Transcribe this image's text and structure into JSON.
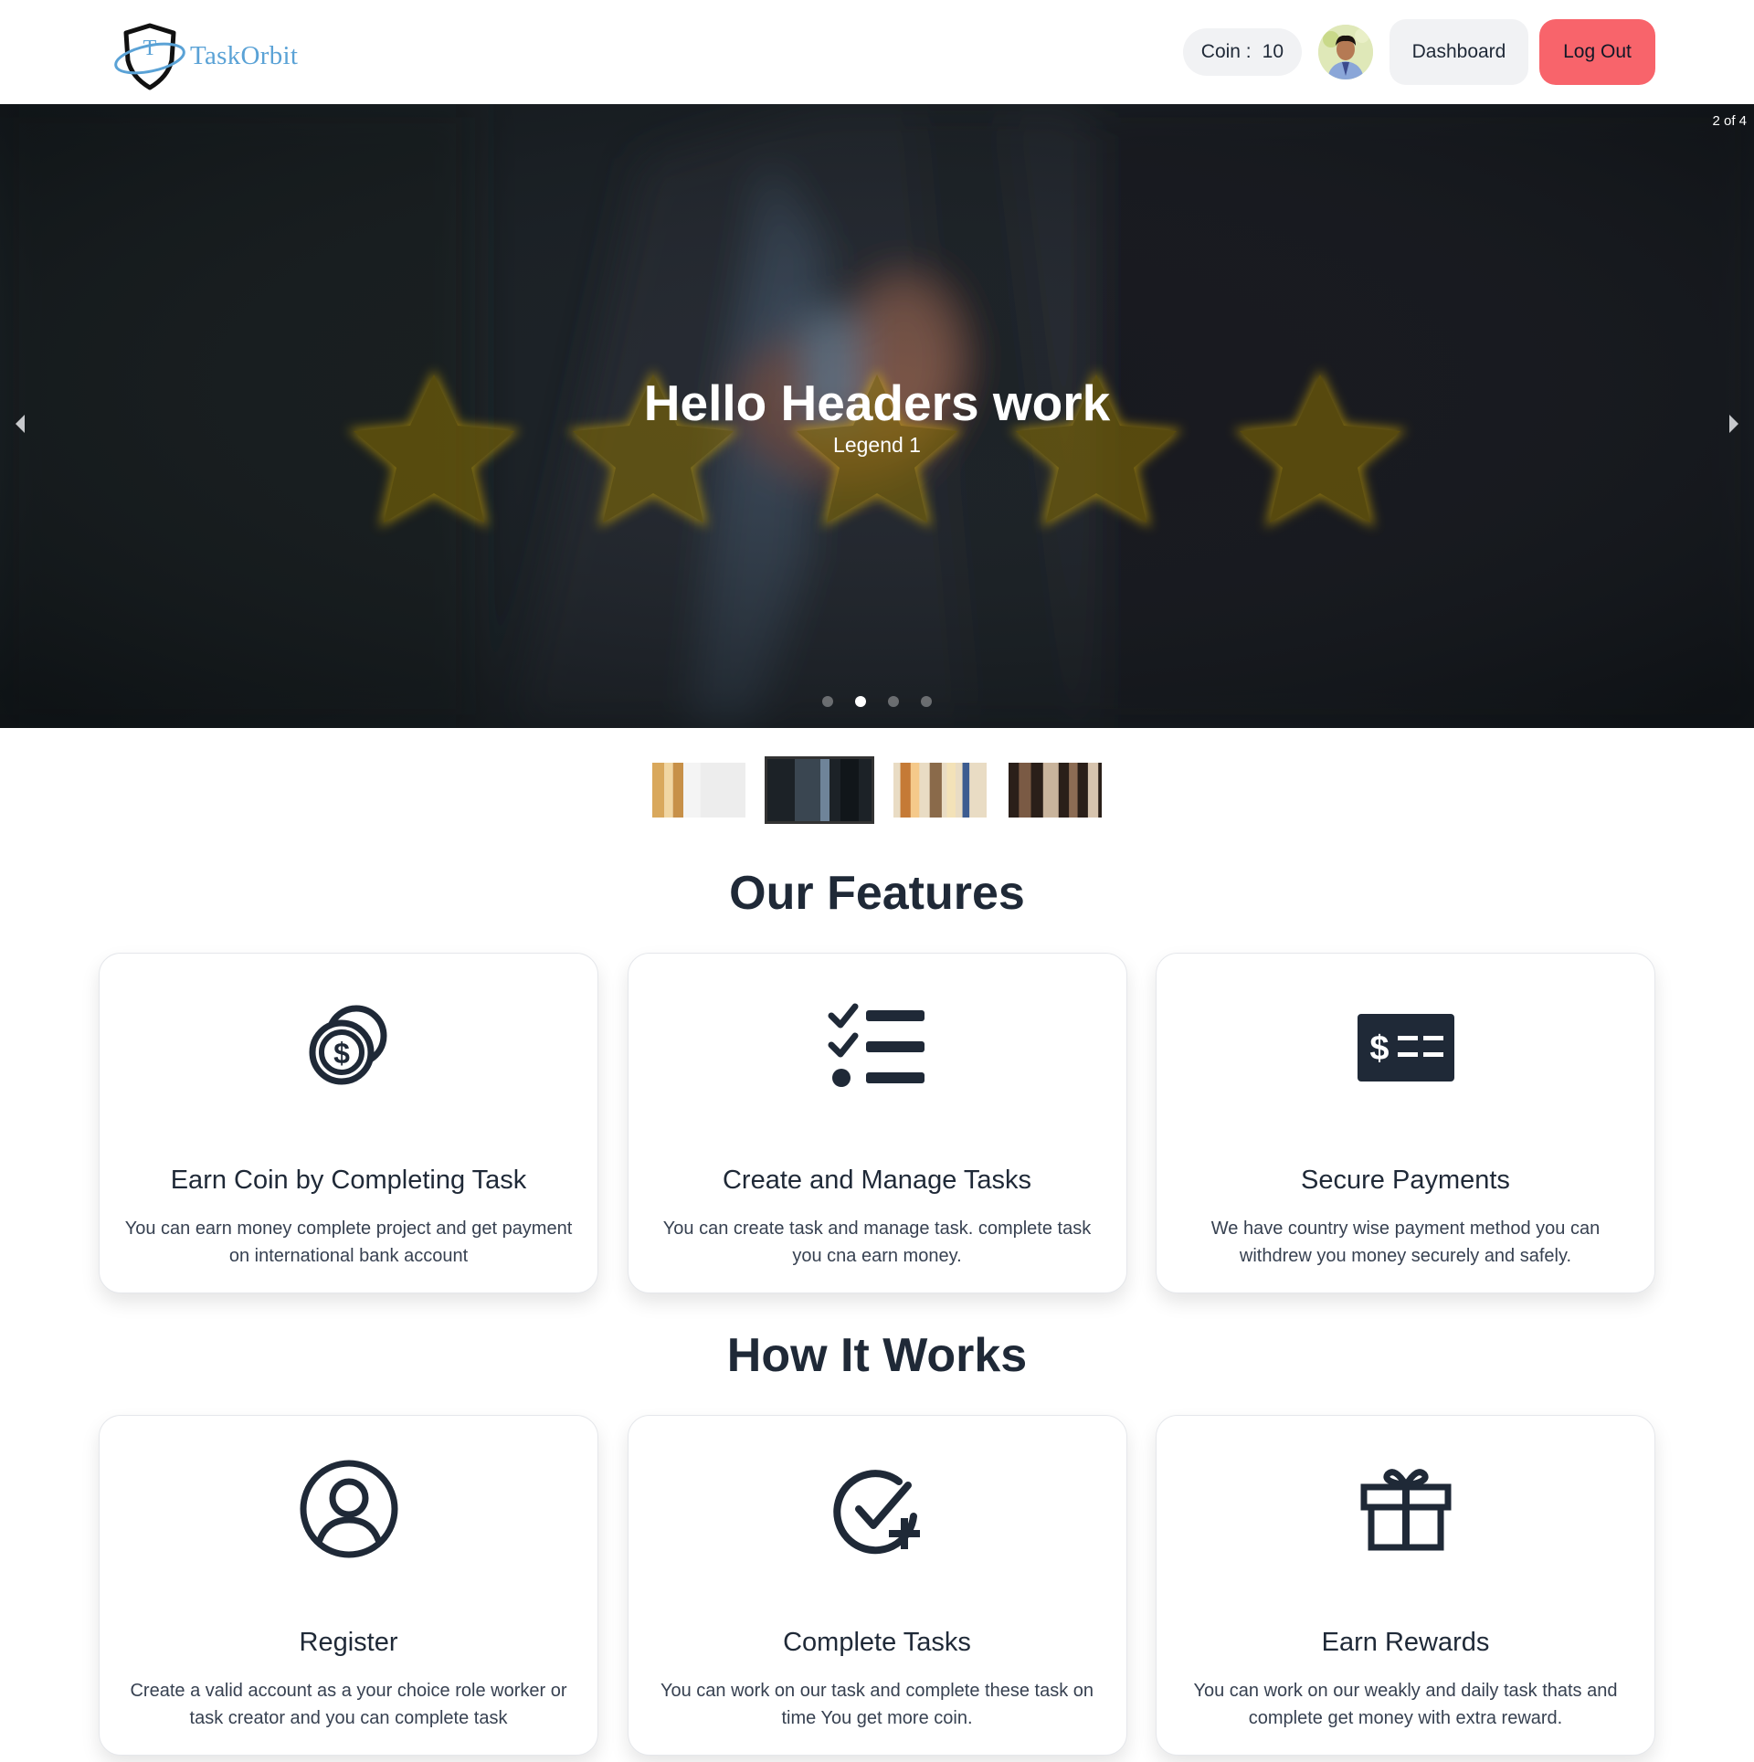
{
  "brand": {
    "name": "TaskOrbit",
    "logo_letter": "T"
  },
  "nav": {
    "coin_label": "Coin :",
    "coin_value": "10",
    "dashboard_label": "Dashboard",
    "logout_label": "Log Out"
  },
  "carousel": {
    "counter": "2 of 4",
    "title": "Hello Headers work",
    "legend": "Legend 1",
    "total_slides": 4,
    "active_slide": 2,
    "prev_icon": "arrow-left-icon",
    "next_icon": "arrow-right-icon"
  },
  "features": {
    "title": "Our Features",
    "cards": [
      {
        "icon": "coins-icon",
        "title": "Earn Coin by Completing Task",
        "text": "You can earn money complete project and get payment on international bank account"
      },
      {
        "icon": "task-list-icon",
        "title": "Create and Manage Tasks",
        "text": "You can create task and manage task. complete task you cna earn money."
      },
      {
        "icon": "payment-check-icon",
        "title": "Secure Payments",
        "text": "We have country wise payment method you can withdrew you money securely and safely."
      }
    ]
  },
  "how_it_works": {
    "title": "How It Works",
    "cards": [
      {
        "icon": "user-circle-icon",
        "title": "Register",
        "text": "Create a valid account as a your choice role worker or task creator and you can complete task"
      },
      {
        "icon": "check-plus-icon",
        "title": "Complete Tasks",
        "text": "You can work on our task and complete these task on time You get more coin."
      },
      {
        "icon": "gift-icon",
        "title": "Earn Rewards",
        "text": "You can work on our weakly and daily task thats and complete get money with extra reward."
      }
    ]
  },
  "colors": {
    "accent_logout": "#f8646b",
    "pill_bg": "#f1f2f4",
    "brand_blue": "#5aa2d6",
    "text_dark": "#1f2937"
  }
}
